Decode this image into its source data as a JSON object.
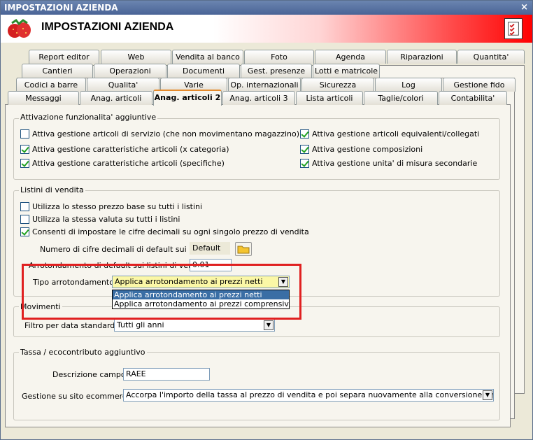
{
  "window": {
    "title": "IMPOSTAZIONI AZIENDA",
    "close_glyph": "×"
  },
  "header": {
    "title": "IMPOSTAZIONI AZIENDA",
    "logo_icon": "strawberries-icon",
    "checklist_icon": "checklist-icon"
  },
  "tabs": {
    "row1": [
      "Report editor",
      "Web",
      "Vendita al banco",
      "Foto",
      "Agenda",
      "Riparazioni",
      "Quantita'"
    ],
    "row2": [
      "Cantieri",
      "Operazioni",
      "Documenti",
      "Gest. presenze",
      "Lotti e matricole"
    ],
    "row3": [
      "Codici a barre",
      "Qualita'",
      "Varie",
      "Op. internazionali",
      "Sicurezza",
      "Log",
      "Gestione fido"
    ],
    "row4": [
      "Messaggi",
      "Anag. articoli",
      "Anag. articoli 2",
      "Anag. articoli 3",
      "Lista articoli",
      "Taglie/colori",
      "Contabilita'"
    ],
    "active": "Anag. articoli 2"
  },
  "attivazione": {
    "title": "Attivazione funzionalita' aggiuntive",
    "options": [
      {
        "label": "Attiva gestione articoli di servizio (che non movimentano magazzino)",
        "checked": false
      },
      {
        "label": "Attiva gestione caratteristiche articoli (x categoria)",
        "checked": true
      },
      {
        "label": "Attiva gestione caratteristiche articoli (specifiche)",
        "checked": true
      },
      {
        "label": "Attiva gestione articoli equivalenti/collegati",
        "checked": true
      },
      {
        "label": "Attiva gestione composizioni",
        "checked": true
      },
      {
        "label": "Attiva gestione unita' di misura secondarie",
        "checked": true
      }
    ]
  },
  "listini": {
    "title": "Listini di vendita",
    "options": [
      {
        "label": "Utilizza lo stesso prezzo base su tutti i listini",
        "checked": false
      },
      {
        "label": "Utilizza la stessa valuta su tutti i listini",
        "checked": false
      },
      {
        "label": "Consenti di impostare le cifre decimali su ogni singolo prezzo di vendita",
        "checked": true
      }
    ],
    "decimali_label": "Numero di cifre decimali di default sui listini :",
    "decimali_value": "Default",
    "arrotondamento_label": "Arrotondamento di default sui listini di vendita :",
    "arrotondamento_value": "0.01",
    "tipo_label": "Tipo arrotondamento :",
    "tipo_value": "Applica arrotondamento ai prezzi netti",
    "tipo_options": [
      "Applica arrotondamento ai prezzi netti",
      "Applica arrotondamento ai prezzi comprensivi di impo"
    ]
  },
  "movimenti": {
    "title": "Movimenti",
    "filtro_label": "Filtro per data standard :",
    "filtro_value": "Tutti gli anni"
  },
  "tassa": {
    "title": "Tassa / ecocontributo aggiuntivo",
    "descrizione_label": "Descrizione campo :",
    "descrizione_value": "RAEE",
    "gestione_label": "Gestione su sito ecommerce :",
    "gestione_value": "Accorpa l'importo della tassa al prezzo di vendita e poi separa nuovamente alla conversione dell'ordine web"
  },
  "colors": {
    "highlight": "#e02020",
    "selection": "#3a6ea5",
    "check": "#21a121",
    "combo_yellow": "#fbf7a6"
  }
}
